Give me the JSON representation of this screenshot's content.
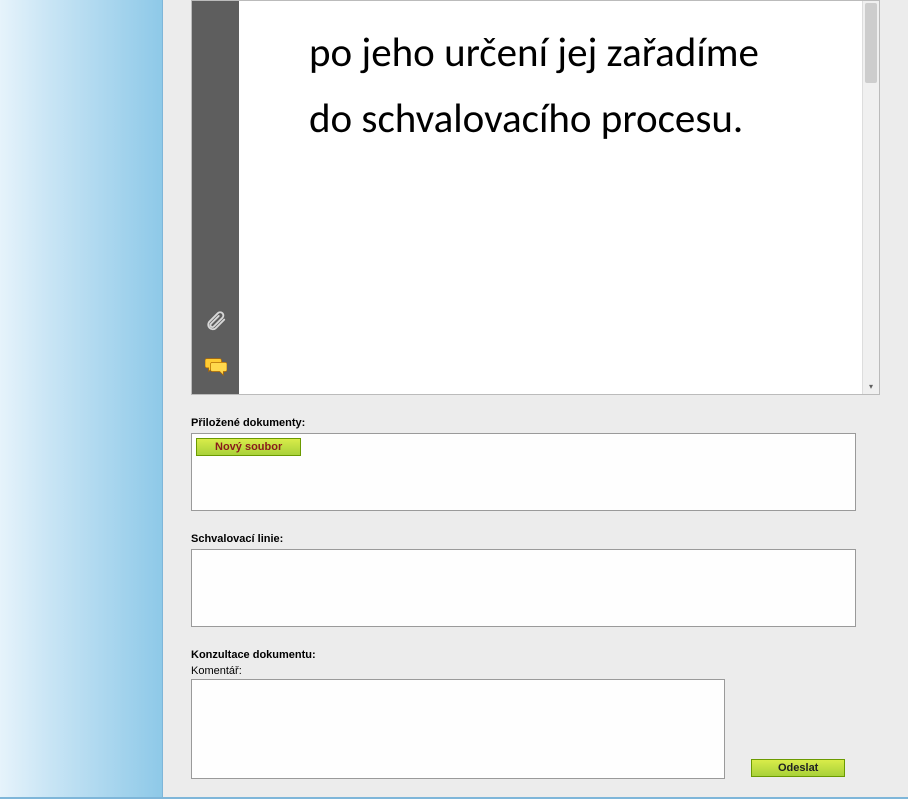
{
  "document": {
    "body_text": "po jeho určení jej zařadíme do schvalovacího procesu."
  },
  "sections": {
    "attachments": {
      "label": "Přiložené dokumenty:",
      "new_file_button": "Nový soubor"
    },
    "approval_line": {
      "label": "Schvalovací linie:"
    },
    "consultation": {
      "label": "Konzultace dokumentu:",
      "comment_label": "Komentář:",
      "comment_value": "",
      "send_button": "Odeslat"
    }
  },
  "icons": {
    "attachment": "attachment-icon",
    "comment": "comment-icon"
  }
}
